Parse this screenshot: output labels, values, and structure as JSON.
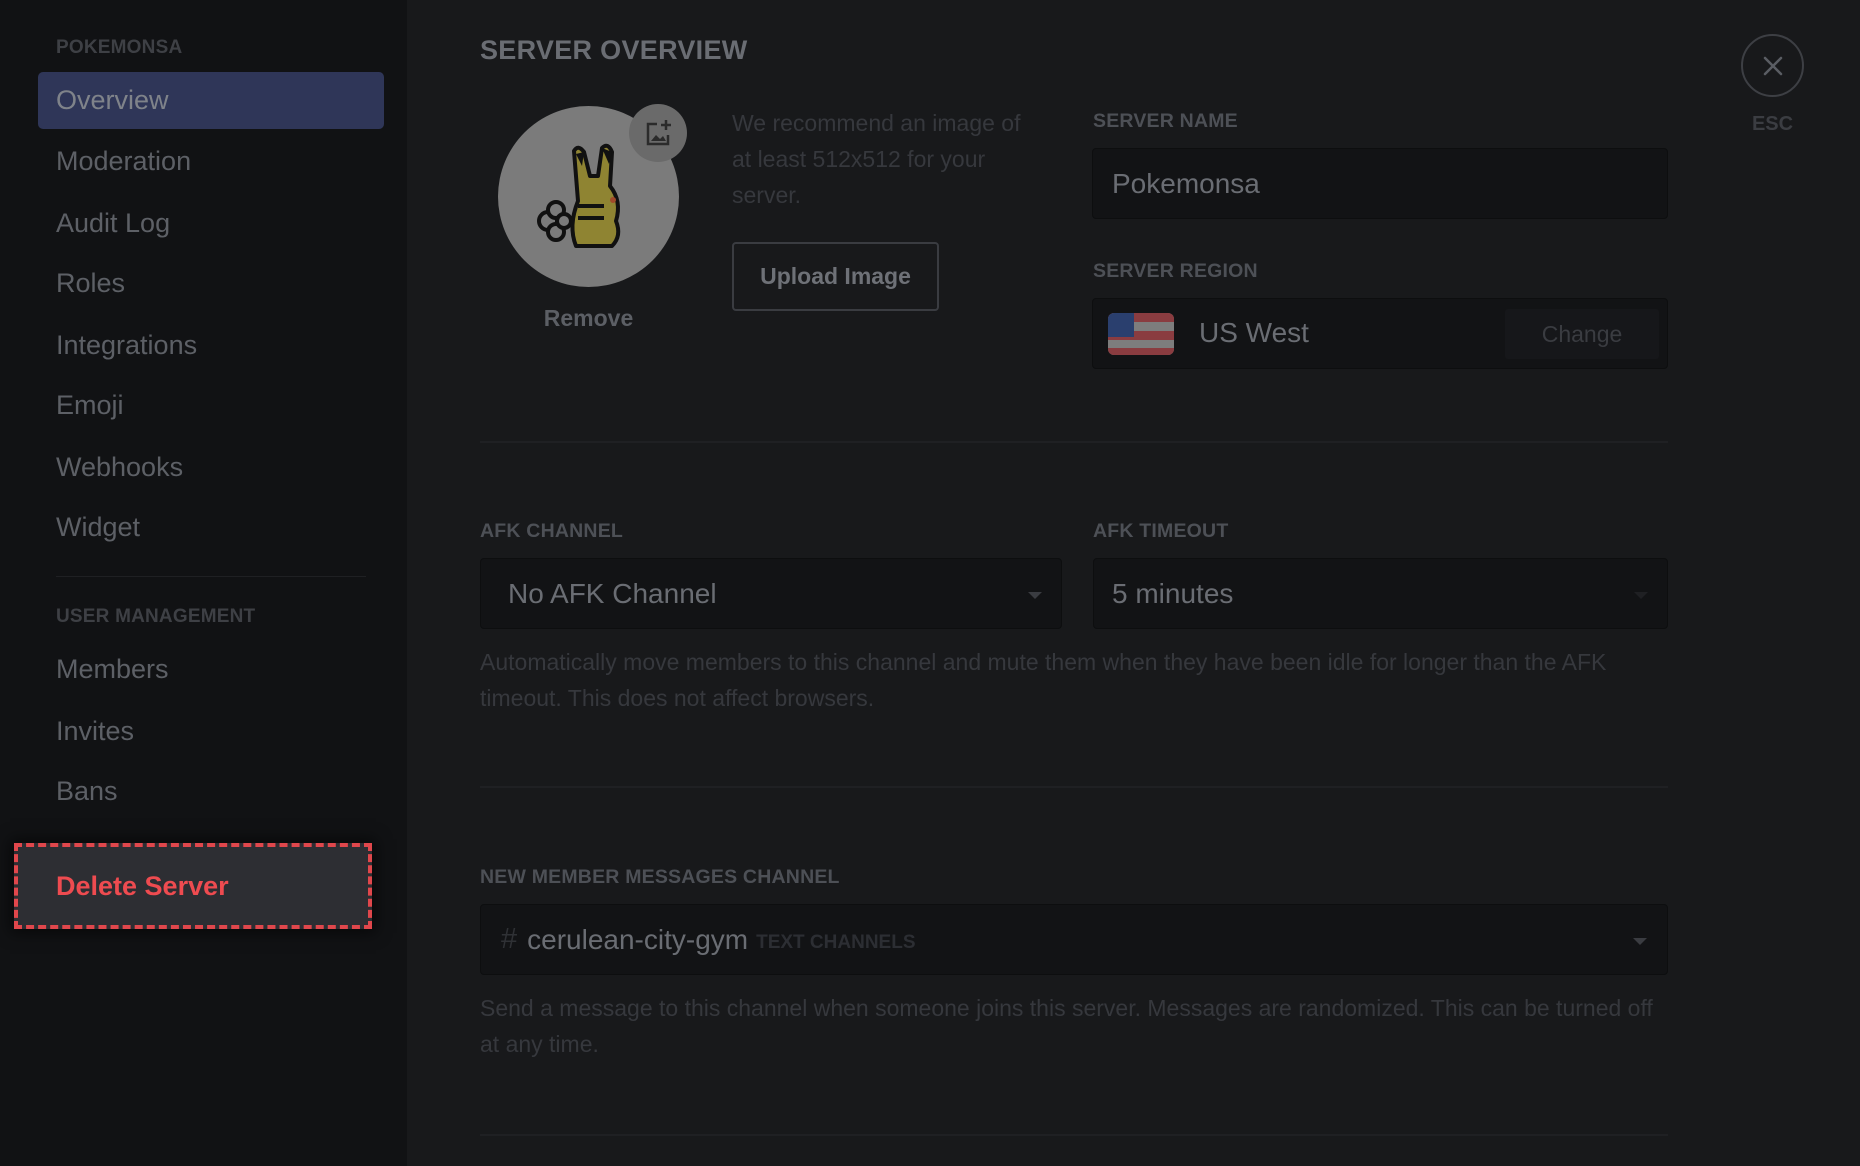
{
  "sidebar": {
    "server_header": "POKEMONSA",
    "items": [
      {
        "label": "Overview",
        "active": true
      },
      {
        "label": "Moderation"
      },
      {
        "label": "Audit Log"
      },
      {
        "label": "Roles"
      },
      {
        "label": "Integrations"
      },
      {
        "label": "Emoji"
      },
      {
        "label": "Webhooks"
      },
      {
        "label": "Widget"
      }
    ],
    "user_management_header": "USER MANAGEMENT",
    "user_items": [
      {
        "label": "Members"
      },
      {
        "label": "Invites"
      },
      {
        "label": "Bans"
      }
    ],
    "delete_label": "Delete Server"
  },
  "main": {
    "title": "SERVER OVERVIEW",
    "icon": {
      "recommend_text": "We recommend an image of at least 512x512 for your server.",
      "upload_label": "Upload Image",
      "remove_label": "Remove",
      "badge_icon": "add-image-icon"
    },
    "server_name": {
      "label": "SERVER NAME",
      "value": "Pokemonsa"
    },
    "server_region": {
      "label": "SERVER REGION",
      "value": "US West",
      "flag_icon": "us-flag-icon",
      "change_label": "Change"
    },
    "afk_channel": {
      "label": "AFK CHANNEL",
      "value": "No AFK Channel"
    },
    "afk_timeout": {
      "label": "AFK TIMEOUT",
      "value": "5 minutes"
    },
    "afk_help": "Automatically move members to this channel and mute them when they have been idle for longer than the AFK timeout. This does not affect browsers.",
    "new_member": {
      "label": "NEW MEMBER MESSAGES CHANNEL",
      "channel_prefix": "#",
      "channel_name": "cerulean-city-gym",
      "category": "TEXT CHANNELS",
      "help": "Send a message to this channel when someone joins this server. Messages are randomized. This can be turned off at any time."
    }
  },
  "close": {
    "icon": "close-icon",
    "label": "ESC"
  },
  "colors": {
    "accent_active": "#2f3658",
    "danger": "#e0474c",
    "sidebar_bg": "#111214",
    "main_bg": "#18191b"
  }
}
